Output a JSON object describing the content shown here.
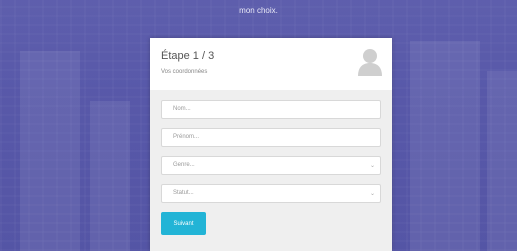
{
  "header": {
    "text": "mon choix."
  },
  "card": {
    "title": "Étape 1 / 3",
    "subtitle": "Vos coordonnées",
    "fields": {
      "nom_placeholder": "Nom...",
      "prenom_placeholder": "Prénom...",
      "genre_value": "Genre...",
      "statut_value": "Statut..."
    },
    "next_label": "Suivant"
  },
  "colors": {
    "overlay": "#5a5ba6",
    "button": "#22b4d6"
  },
  "icons": {
    "avatar": "user-avatar-icon",
    "dropdown": "chevron-down-icon"
  }
}
